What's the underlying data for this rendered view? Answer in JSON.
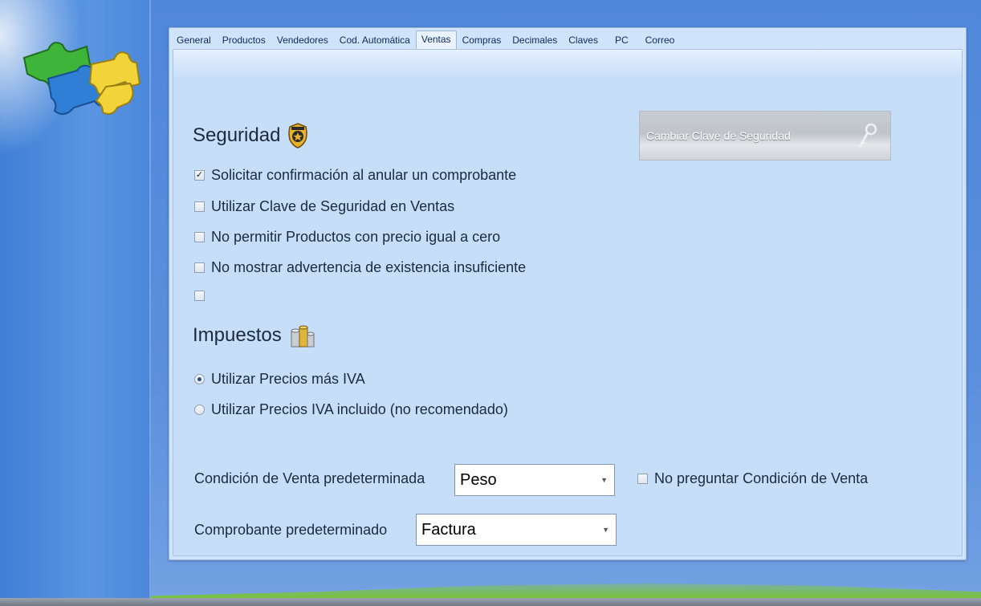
{
  "tabs": [
    "General",
    "Productos",
    "Vendedores",
    "Cod. Automática",
    "Ventas",
    "Compras",
    "Decimales",
    "Claves",
    "PC",
    "Correo"
  ],
  "active_tab": "Ventas",
  "seguridad": {
    "title": "Seguridad",
    "icon": "security-badge-icon",
    "options": [
      {
        "label": "Solicitar confirmación al anular un comprobante",
        "checked": true
      },
      {
        "label": "Utilizar Clave de Seguridad en Ventas",
        "checked": false
      },
      {
        "label": "No permitir Productos con precio igual a cero",
        "checked": false
      },
      {
        "label": "No mostrar advertencia de existencia insuficiente",
        "checked": false
      },
      {
        "label": "",
        "checked": false
      }
    ],
    "change_key_button": "Cambiar Clave de Seguridad"
  },
  "impuestos": {
    "title": "Impuestos",
    "icon": "coins-icon",
    "options": [
      {
        "label": "Utilizar Precios más IVA",
        "selected": true
      },
      {
        "label": "Utilizar Precios IVA incluido (no recomendado)",
        "selected": false
      }
    ]
  },
  "condicion_venta": {
    "label": "Condición de Venta predeterminada",
    "value": "Peso",
    "no_preguntar_label": "No preguntar Condición de Venta",
    "no_preguntar_checked": false
  },
  "comprobante": {
    "label": "Comprobante predeterminado",
    "value": "Factura"
  },
  "colors": {
    "background": "#5a8fdc",
    "panel": "#c7def9",
    "text": "#1c2a3c"
  }
}
